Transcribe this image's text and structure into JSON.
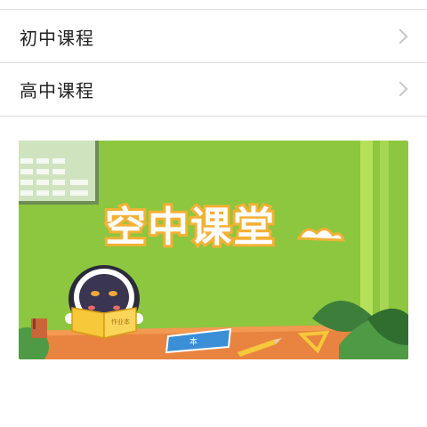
{
  "menu": {
    "items": [
      {
        "label": "初中课程",
        "icon": "chevron-right-icon"
      },
      {
        "label": "高中课程",
        "icon": "chevron-right-icon"
      }
    ]
  },
  "banner": {
    "title": "空中课堂",
    "book_label": "作业本",
    "notebook_label": "本",
    "colors": {
      "wall": "#8dc63f",
      "wall_light": "#a6d652",
      "desk": "#e8843f",
      "title_text": "#ffffff",
      "title_outline": "#f2b135"
    }
  }
}
